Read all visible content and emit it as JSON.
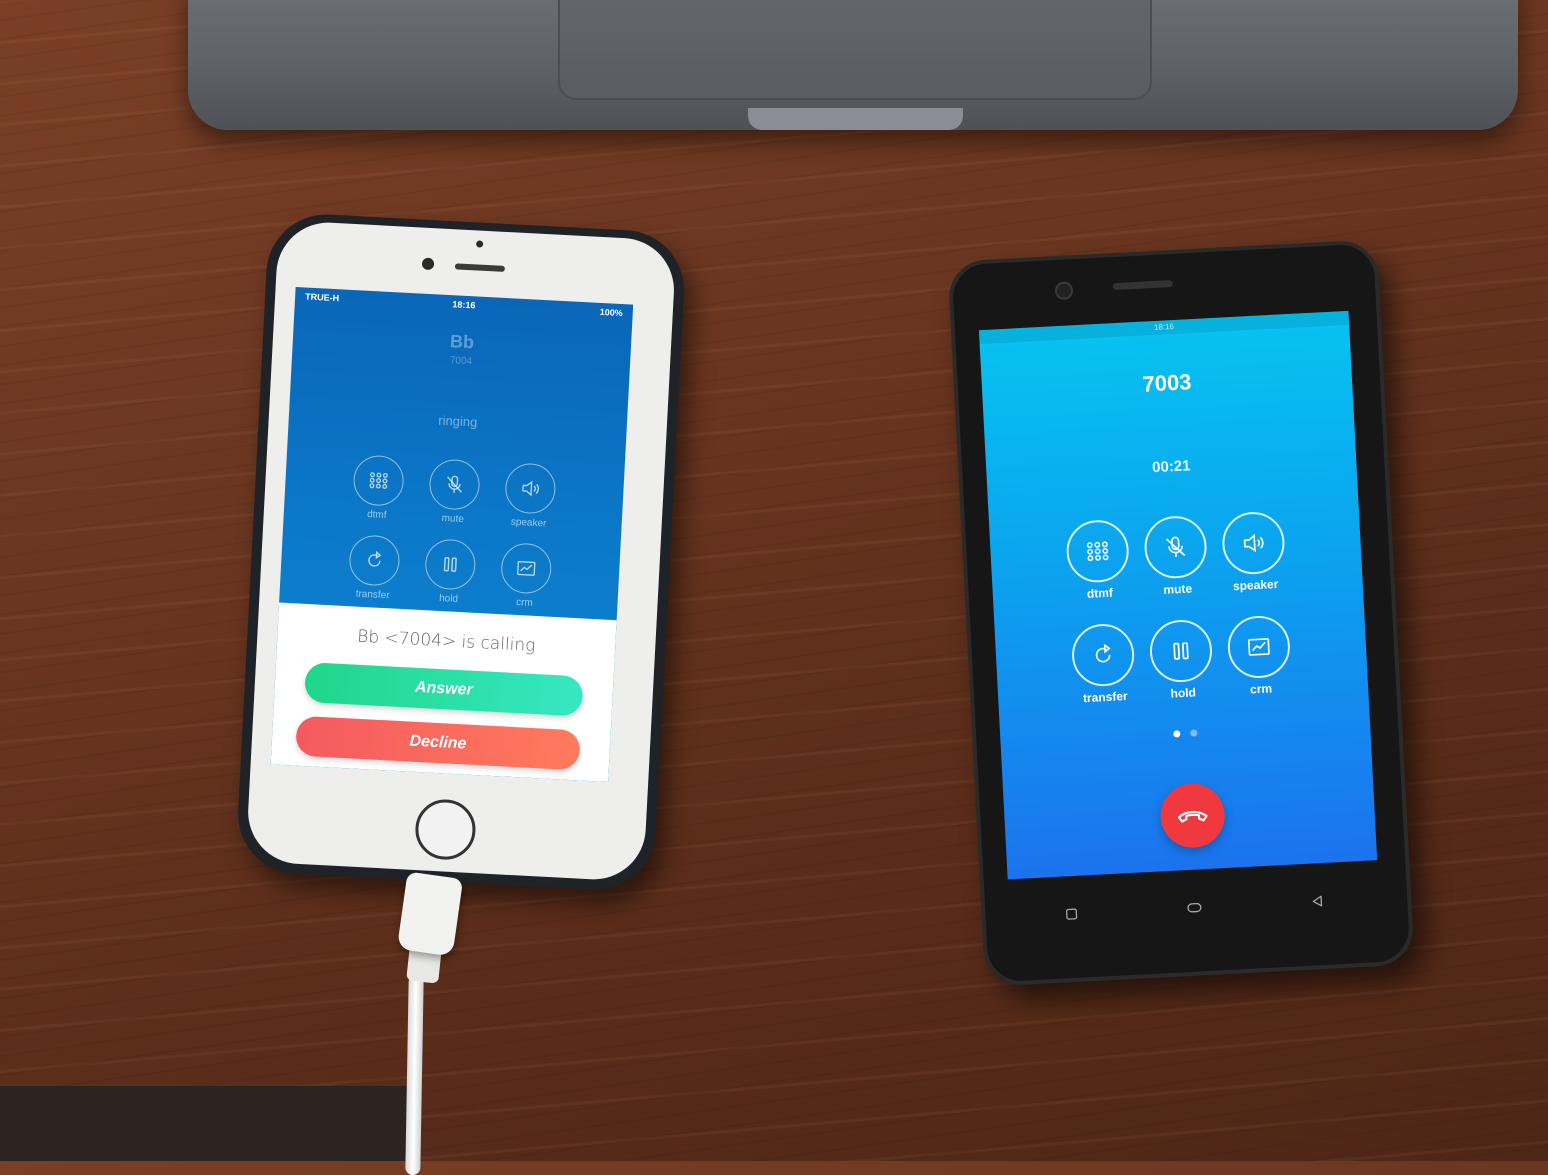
{
  "iphone": {
    "status": {
      "carrier": "TRUE-H",
      "time": "18:16",
      "battery": "100%"
    },
    "caller": {
      "name": "Bb",
      "number": "7004",
      "state": "ringing"
    },
    "controls_row1": [
      {
        "label": "dtmf",
        "icon": "keypad-icon"
      },
      {
        "label": "mute",
        "icon": "mic-icon"
      },
      {
        "label": "speaker",
        "icon": "speaker-icon"
      }
    ],
    "controls_row2": [
      {
        "label": "transfer",
        "icon": "transfer-icon"
      },
      {
        "label": "hold",
        "icon": "pause-icon"
      },
      {
        "label": "crm",
        "icon": "chart-icon"
      }
    ],
    "incoming": {
      "text": "Bb <7004> is calling",
      "answer_label": "Answer",
      "decline_label": "Decline"
    }
  },
  "android": {
    "status": {
      "time": "18:16"
    },
    "number": "7003",
    "timer": "00:21",
    "controls_row1": [
      {
        "label": "dtmf",
        "icon": "keypad-icon"
      },
      {
        "label": "mute",
        "icon": "mic-icon"
      },
      {
        "label": "speaker",
        "icon": "speaker-icon"
      }
    ],
    "controls_row2": [
      {
        "label": "transfer",
        "icon": "transfer-icon"
      },
      {
        "label": "hold",
        "icon": "pause-icon"
      },
      {
        "label": "crm",
        "icon": "chart-icon"
      }
    ],
    "active_page": 1,
    "pages": 2
  },
  "colors": {
    "answer": "#1fd68a",
    "decline": "#f45a5f",
    "hangup": "#f0393f",
    "iphone_screen": "#0b77c7",
    "android_screen": "#0aa6ef"
  }
}
